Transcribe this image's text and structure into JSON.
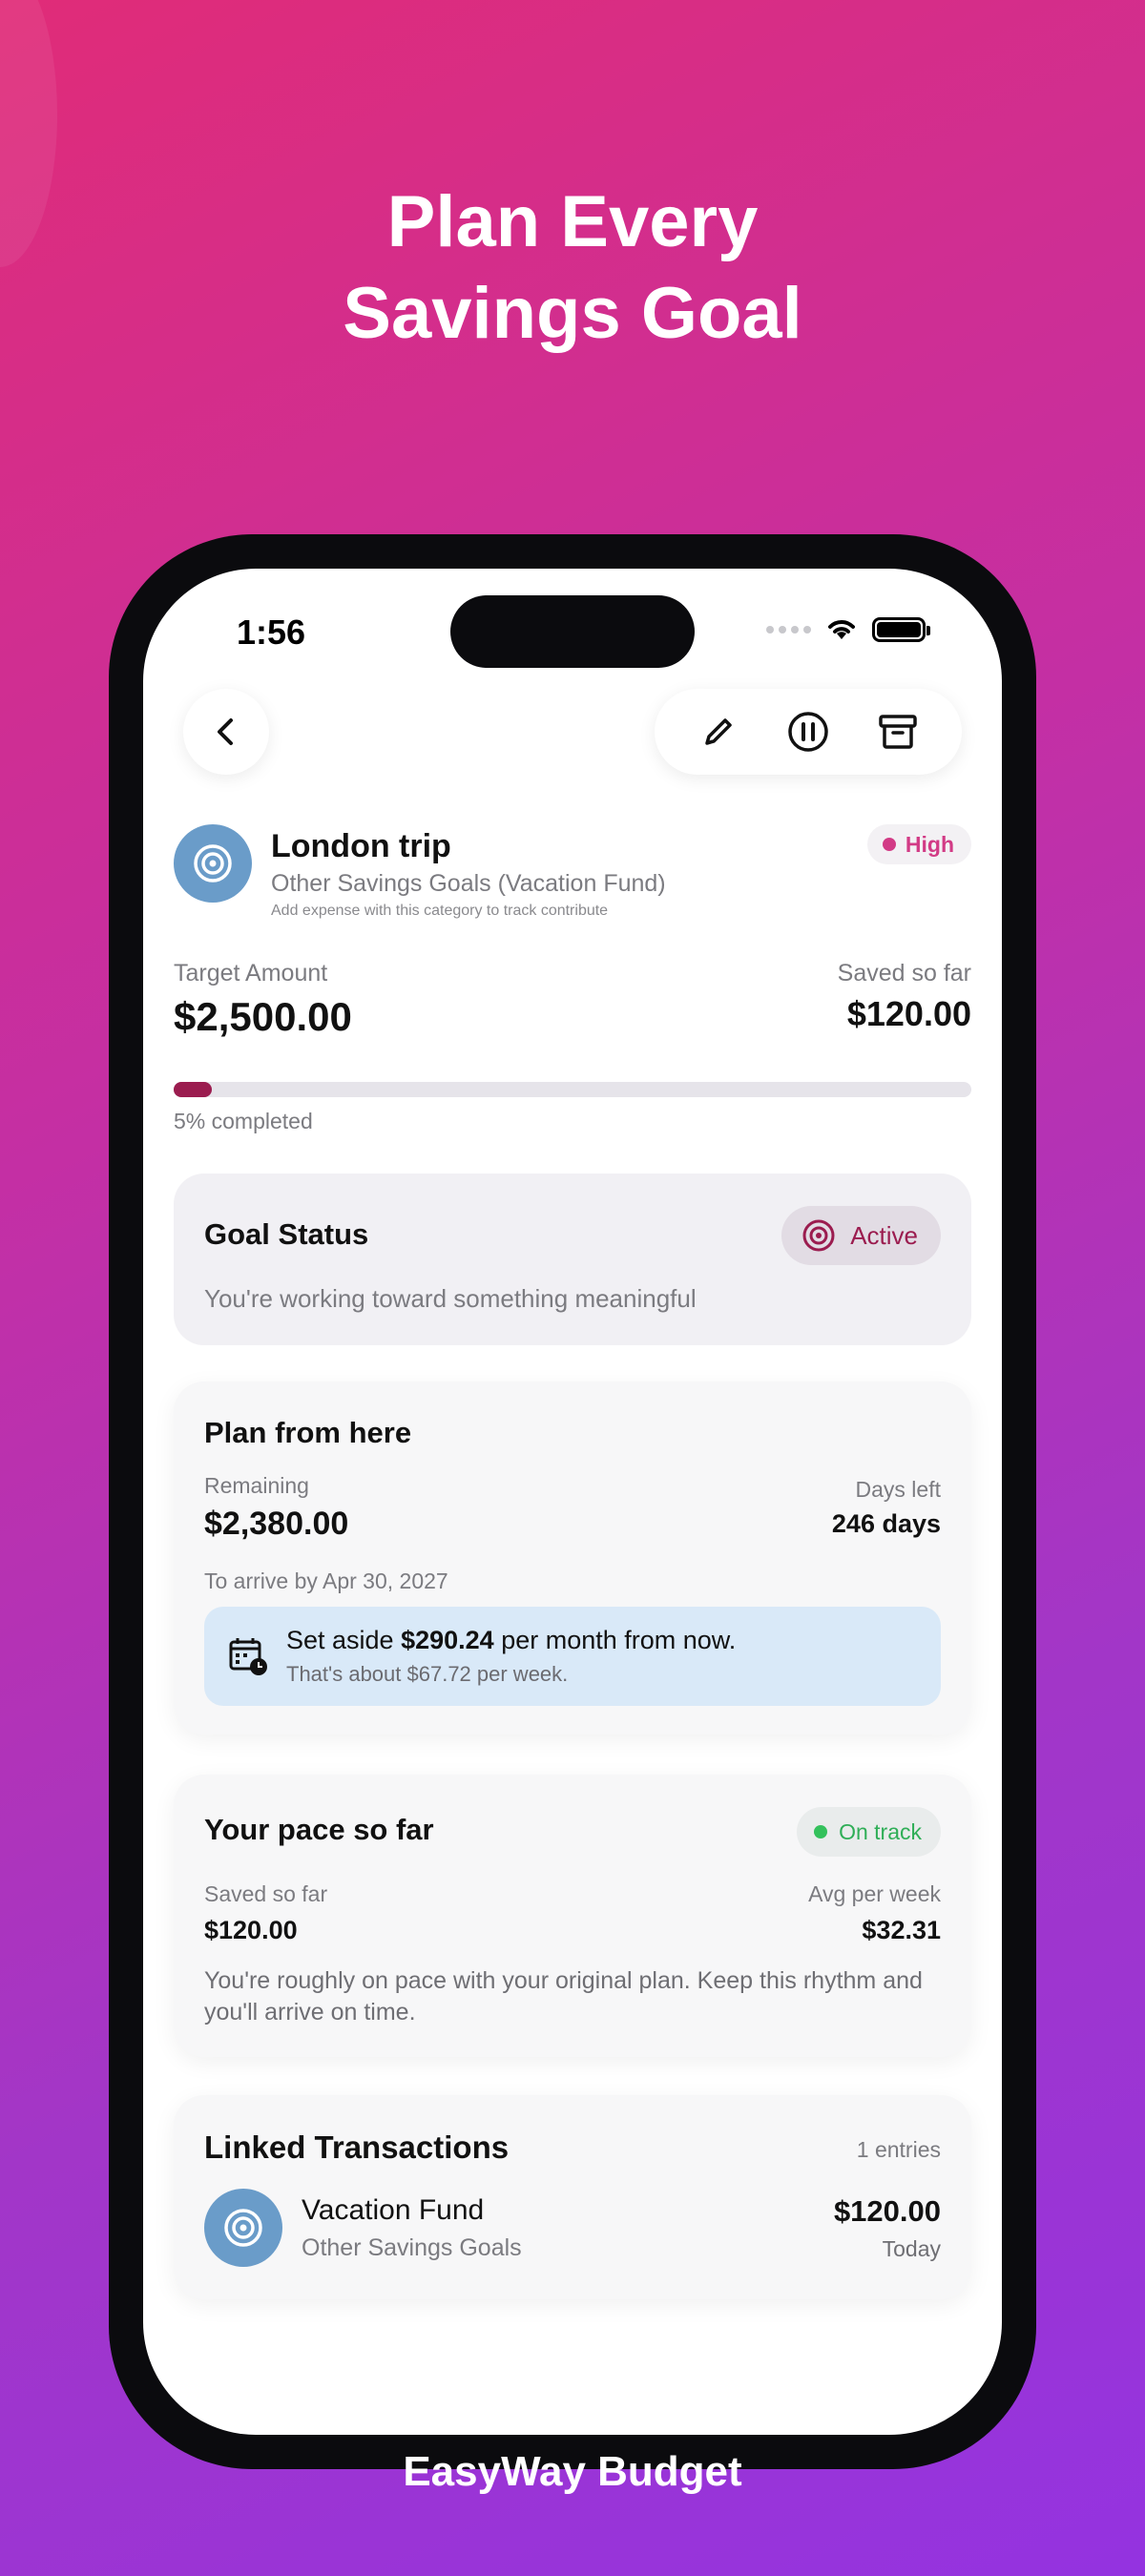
{
  "headline": {
    "line1": "Plan Every",
    "line2": "Savings Goal"
  },
  "brand": "EasyWay Budget",
  "status_bar": {
    "time": "1:56"
  },
  "toolbar": {
    "back_icon": "chevron-left-icon",
    "edit_icon": "pencil-icon",
    "pause_icon": "pause-circle-icon",
    "archive_icon": "archive-box-icon"
  },
  "goal": {
    "title": "London trip",
    "subtitle": "Other Savings Goals (Vacation Fund)",
    "hint": "Add expense with this category to track contribute",
    "icon": "target-icon",
    "priority": "High",
    "target_label": "Target Amount",
    "target_value": "$2,500.00",
    "saved_label": "Saved so far",
    "saved_value": "$120.00",
    "progress_fraction": 0.048,
    "progress_text": "5% completed"
  },
  "status_card": {
    "title": "Goal Status",
    "badge": "Active",
    "message": "You're working toward something meaningful"
  },
  "plan_card": {
    "title": "Plan from here",
    "remaining_label": "Remaining",
    "remaining_value": "$2,380.00",
    "days_left_label": "Days left",
    "days_left_value": "246 days",
    "arrive_by": "To arrive by Apr 30, 2027",
    "set_aside_prefix": "Set aside ",
    "set_aside_amount": "$290.24",
    "set_aside_suffix": " per month from now.",
    "per_week": "That's about $67.72 per week."
  },
  "pace_card": {
    "title": "Your pace so far",
    "badge": "On track",
    "saved_label": "Saved so far",
    "saved_value": "$120.00",
    "avg_label": "Avg per week",
    "avg_value": "$32.31",
    "message": "You're roughly on pace with your original plan. Keep this rhythm and you'll arrive on time."
  },
  "linked_card": {
    "title": "Linked Transactions",
    "count": "1 entries",
    "transactions": [
      {
        "name": "Vacation Fund",
        "category": "Other Savings Goals",
        "amount": "$120.00",
        "date": "Today"
      }
    ]
  },
  "colors": {
    "accent": "#9b1c4f",
    "priority": "#d23b86",
    "on_track": "#34c15c",
    "avatar": "#6a9cc9"
  }
}
